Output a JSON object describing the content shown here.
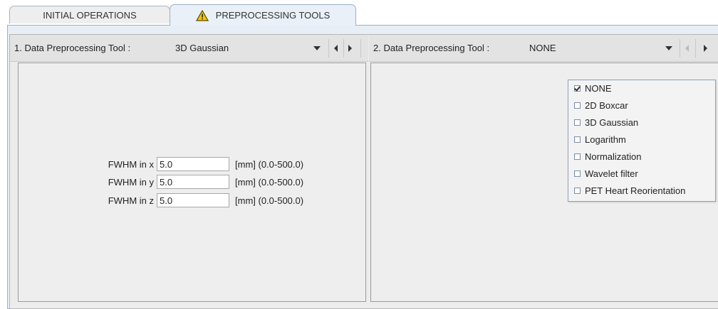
{
  "tabs": [
    {
      "label": "INITIAL OPERATIONS",
      "active": false
    },
    {
      "label": "PREPROCESSING TOOLS",
      "active": true,
      "icon": "warning-icon"
    }
  ],
  "tool1": {
    "label": "1. Data Preprocessing Tool :",
    "value": "3D Gaussian",
    "params": [
      {
        "label": "FWHM in x",
        "value": "5.0",
        "range": "[mm]  (0.0-500.0)"
      },
      {
        "label": "FWHM in y",
        "value": "5.0",
        "range": "[mm]  (0.0-500.0)"
      },
      {
        "label": "FWHM in z",
        "value": "5.0",
        "range": "[mm]  (0.0-500.0)"
      }
    ]
  },
  "tool2": {
    "label": "2. Data Preprocessing Tool :",
    "value": "NONE",
    "menu": [
      {
        "label": "NONE",
        "checked": true
      },
      {
        "label": "2D Boxcar",
        "checked": false
      },
      {
        "label": "3D Gaussian",
        "checked": false
      },
      {
        "label": "Logarithm",
        "checked": false
      },
      {
        "label": "Normalization",
        "checked": false
      },
      {
        "label": "Wavelet filter",
        "checked": false
      },
      {
        "label": "PET Heart Reorientation",
        "checked": false
      }
    ]
  },
  "colors": {
    "accent": "#9db0c4",
    "warning": "#f5c400"
  }
}
